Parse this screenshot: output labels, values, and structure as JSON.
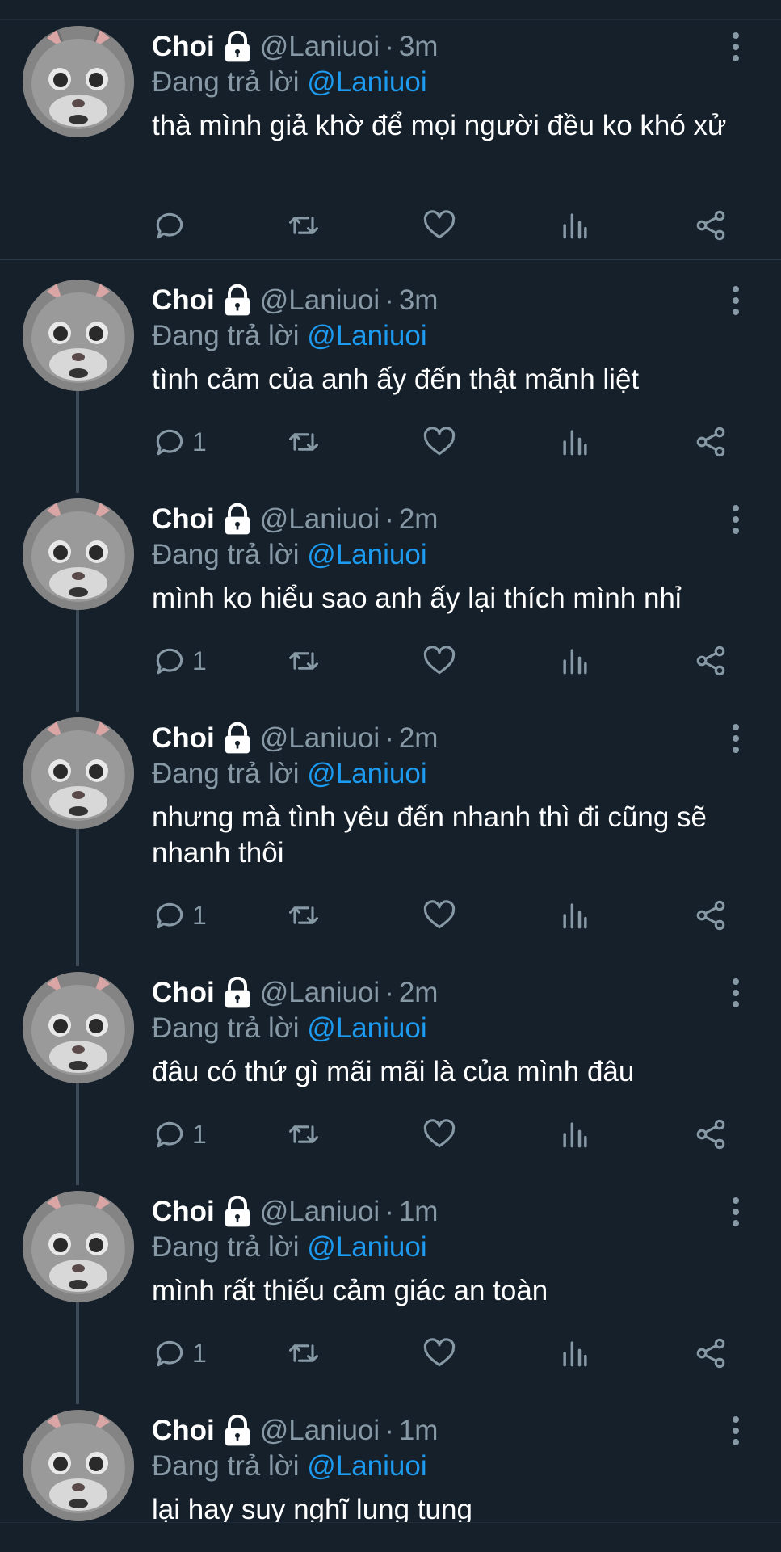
{
  "colors": {
    "background": "#15202b",
    "secondary_text": "#8899a6",
    "mention": "#1d9bf0",
    "separator": "#2c3a47"
  },
  "tweets": [
    {
      "name": "Choi",
      "handle": "@Laniuoi",
      "time": "3m",
      "reply_prefix": "Đang trả lời",
      "reply_to": "@Laniuoi",
      "text": "thà mình giả khờ để mọi người đều ko khó xử",
      "reply_count": ""
    },
    {
      "name": "Choi",
      "handle": "@Laniuoi",
      "time": "3m",
      "reply_prefix": "Đang trả lời",
      "reply_to": "@Laniuoi",
      "text": "tình cảm của anh ấy đến thật mãnh liệt",
      "reply_count": "1"
    },
    {
      "name": "Choi",
      "handle": "@Laniuoi",
      "time": "2m",
      "reply_prefix": "Đang trả lời",
      "reply_to": "@Laniuoi",
      "text": "mình ko hiểu sao anh ấy lại thích mình nhỉ",
      "reply_count": "1"
    },
    {
      "name": "Choi",
      "handle": "@Laniuoi",
      "time": "2m",
      "reply_prefix": "Đang trả lời",
      "reply_to": "@Laniuoi",
      "text": "nhưng mà tình yêu đến nhanh thì đi cũng sẽ nhanh thôi",
      "reply_count": "1"
    },
    {
      "name": "Choi",
      "handle": "@Laniuoi",
      "time": "2m",
      "reply_prefix": "Đang trả lời",
      "reply_to": "@Laniuoi",
      "text": "đâu có thứ gì mãi mãi là của mình đâu",
      "reply_count": "1"
    },
    {
      "name": "Choi",
      "handle": "@Laniuoi",
      "time": "1m",
      "reply_prefix": "Đang trả lời",
      "reply_to": "@Laniuoi",
      "text": "mình rất thiếu cảm giác an toàn",
      "reply_count": "1"
    },
    {
      "name": "Choi",
      "handle": "@Laniuoi",
      "time": "1m",
      "reply_prefix": "Đang trả lời",
      "reply_to": "@Laniuoi",
      "text": "lại hay suy nghĩ lung tung",
      "reply_count": ""
    }
  ],
  "icons": {
    "reply": "reply-icon",
    "retweet": "retweet-icon",
    "like": "heart-icon",
    "views": "analytics-icon",
    "share": "share-icon",
    "more": "more-vertical-icon",
    "lock": "lock-icon"
  }
}
